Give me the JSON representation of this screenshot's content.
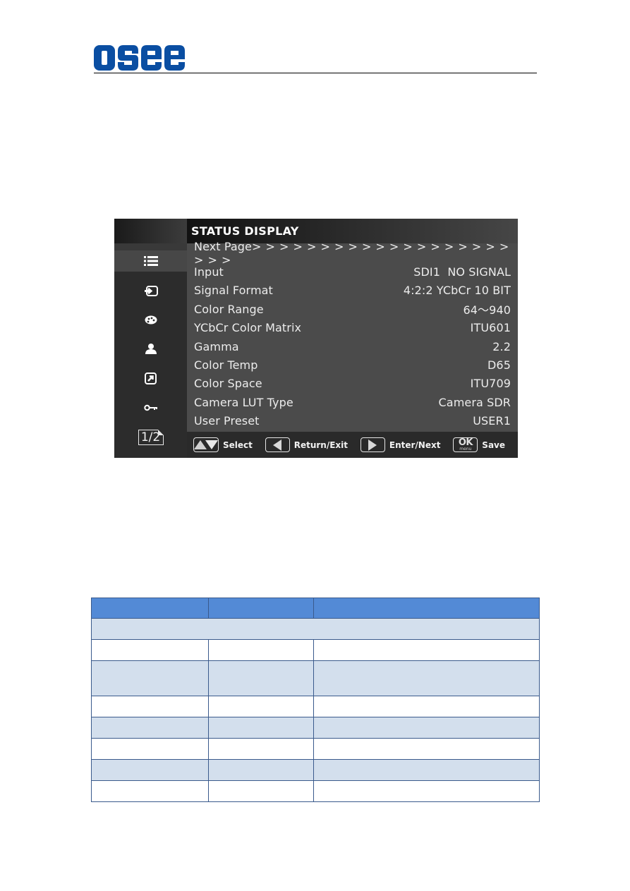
{
  "header": {
    "logo_text": "osee",
    "brand_color": "#0a4ea2"
  },
  "osd": {
    "title": "STATUS DISPLAY",
    "sidebar": {
      "items": [
        {
          "icon": "list-icon",
          "active": true
        },
        {
          "icon": "input-icon",
          "active": false
        },
        {
          "icon": "palette-icon",
          "active": false
        },
        {
          "icon": "user-icon",
          "active": false
        },
        {
          "icon": "shortcut-icon",
          "active": false
        },
        {
          "icon": "key-icon",
          "active": false
        }
      ],
      "page_indicator": "1/2"
    },
    "rows": [
      {
        "label": "Next Page",
        "value": "> > > > > > > > > > > > > > > > > > > > > >"
      },
      {
        "label": "Input",
        "value": "SDI1  NO SIGNAL"
      },
      {
        "label": "Signal Format",
        "value": "4:2:2 YCbCr 10 BIT"
      },
      {
        "label": "Color Range",
        "value": "64～940"
      },
      {
        "label": "YCbCr Color Matrix",
        "value": "ITU601"
      },
      {
        "label": "Gamma",
        "value": "2.2"
      },
      {
        "label": "Color Temp",
        "value": "D65"
      },
      {
        "label": "Color Space",
        "value": "ITU709"
      },
      {
        "label": "Camera LUT Type",
        "value": "Camera SDR"
      },
      {
        "label": "User Preset",
        "value": "USER1"
      }
    ],
    "footer": {
      "select": "Select",
      "return": "Return/Exit",
      "enter": "Enter/Next",
      "ok_top": "OK",
      "ok_bottom": "menu",
      "save": "Save"
    }
  },
  "table": {
    "header_color": "#538ad6",
    "band_color": "#d3dfed",
    "border_color": "#3a5a8c",
    "columns": [
      "",
      "",
      ""
    ],
    "rows": [
      {
        "span": true,
        "cells": [
          ""
        ]
      },
      {
        "cells": [
          "",
          "",
          ""
        ]
      },
      {
        "cells": [
          "",
          "",
          ""
        ],
        "tall": true
      },
      {
        "cells": [
          "",
          "",
          ""
        ]
      },
      {
        "cells": [
          "",
          "",
          ""
        ]
      },
      {
        "cells": [
          "",
          "",
          ""
        ]
      },
      {
        "cells": [
          "",
          "",
          ""
        ]
      },
      {
        "cells": [
          "",
          "",
          ""
        ]
      }
    ]
  }
}
